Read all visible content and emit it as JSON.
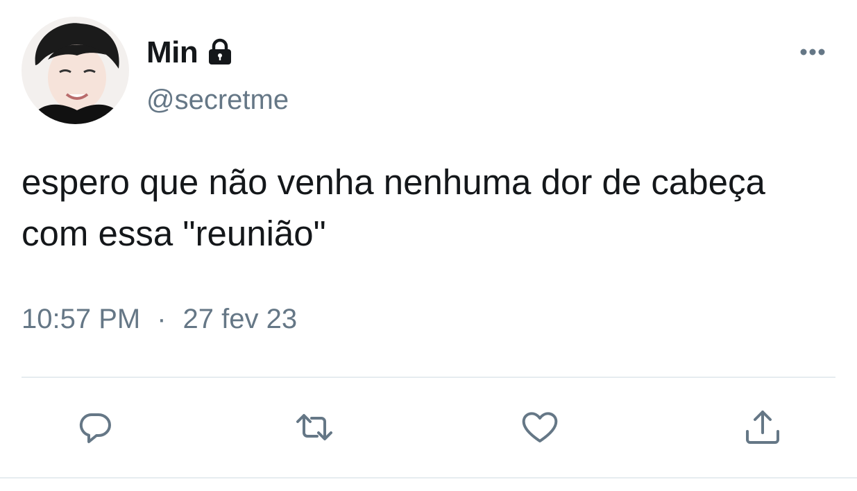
{
  "user": {
    "display_name": "Min",
    "handle": "@secretme",
    "protected_icon": "lock-icon",
    "avatar": "avatar-photo"
  },
  "tweet": {
    "text": "espero que não venha nenhuma dor de cabeça com essa \"reunião\"",
    "time": "10:57 PM",
    "separator": "·",
    "date": "27 fev 23"
  },
  "actions": [
    {
      "name": "reply",
      "icon": "reply-icon"
    },
    {
      "name": "retweet",
      "icon": "retweet-icon"
    },
    {
      "name": "like",
      "icon": "heart-icon"
    },
    {
      "name": "share",
      "icon": "share-icon"
    }
  ],
  "menu_icon": "more-options-icon",
  "colors": {
    "text_primary": "#14171a",
    "text_secondary": "#657786",
    "divider": "#e6ecf0"
  }
}
